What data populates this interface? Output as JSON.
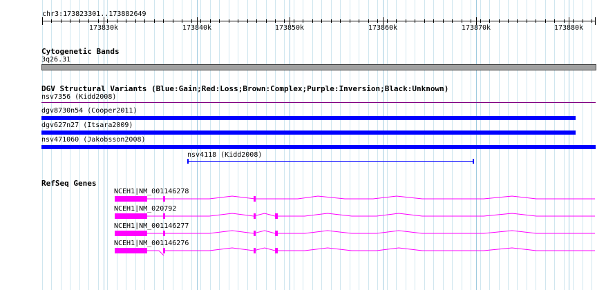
{
  "ruler": {
    "title": "chr3:173823301..173882649",
    "ticks": [
      "173830k",
      "173840k",
      "173850k",
      "173860k",
      "173870k",
      "173880k"
    ]
  },
  "cytogenetic": {
    "title": "Cytogenetic Bands",
    "band": "3q26.31"
  },
  "dgv": {
    "title": "DGV Structural Variants (Blue:Gain;Red:Loss;Brown:Complex;Purple:Inversion;Black:Unknown)",
    "variants": [
      {
        "label": "nsv7356 (Kidd2008)",
        "color": "#800080"
      },
      {
        "label": "dgv8730n54 (Cooper2011)",
        "color": "#0000ff"
      },
      {
        "label": "dgv627n27 (Itsara2009)",
        "color": "#0000ff"
      },
      {
        "label": "nsv471060 (Jakobsson2008)",
        "color": "#0000ff"
      },
      {
        "label": "nsv4118 (Kidd2008)",
        "color": "#0000ff"
      }
    ]
  },
  "refseq": {
    "title": "RefSeq Genes",
    "genes": [
      {
        "label": "NCEH1|NM_001146278"
      },
      {
        "label": "NCEH1|NM_020792"
      },
      {
        "label": "NCEH1|NM_001146277"
      },
      {
        "label": "NCEH1|NM_001146276"
      }
    ],
    "color": "#ff00ff"
  }
}
